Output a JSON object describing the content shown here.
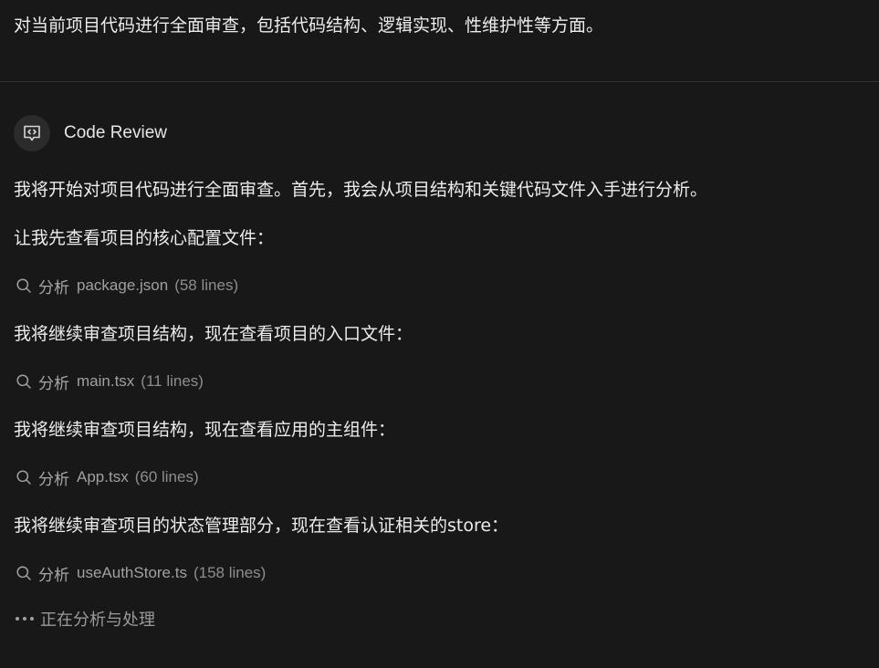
{
  "user_prompt": "对当前项目代码进行全面审查，包括代码结构、逻辑实现、性维护性等方面。",
  "agent": {
    "name": "Code Review",
    "icon": "code-review-icon"
  },
  "messages": [
    "我将开始对项目代码进行全面审查。首先，我会从项目结构和关键代码文件入手进行分析。",
    "让我先查看项目的核心配置文件：",
    "我将继续审查项目结构，现在查看项目的入口文件：",
    "我将继续审查项目结构，现在查看应用的主组件：",
    "我将继续审查项目的状态管理部分，现在查看认证相关的store："
  ],
  "actions": [
    {
      "icon": "search-icon",
      "verb": "分析",
      "file": "package.json",
      "lines": "(58 lines)"
    },
    {
      "icon": "search-icon",
      "verb": "分析",
      "file": "main.tsx",
      "lines": "(11 lines)"
    },
    {
      "icon": "search-icon",
      "verb": "分析",
      "file": "App.tsx",
      "lines": "(60 lines)"
    },
    {
      "icon": "search-icon",
      "verb": "分析",
      "file": "useAuthStore.ts",
      "lines": "(158 lines)"
    }
  ],
  "status": {
    "icon": "ellipsis-icon",
    "text": "正在分析与处理"
  },
  "colors": {
    "background": "#181818",
    "text": "#ececec",
    "muted": "#9a9a9a",
    "divider": "#333333",
    "icon_bg": "#2b2b2b"
  }
}
